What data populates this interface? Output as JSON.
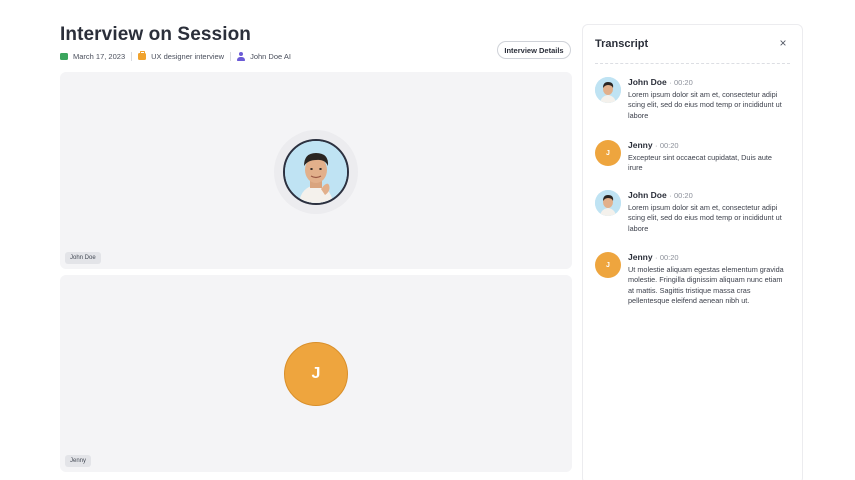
{
  "header": {
    "title": "Interview on Session",
    "date": "March 17, 2023",
    "position": "UX designer interview",
    "interviewer": "John Doe AI",
    "details_button": "Interview Details"
  },
  "video": {
    "tiles": [
      {
        "name": "John Doe",
        "initial": ""
      },
      {
        "name": "Jenny",
        "initial": "J"
      }
    ]
  },
  "transcript": {
    "title": "Transcript",
    "close_symbol": "×",
    "entries": [
      {
        "speaker": "John Doe",
        "separator": "·",
        "time": "00:20",
        "text": "Lorem ipsum dolor sit am et, consectetur adipi scing elit, sed do eius mod temp or incididunt ut labore",
        "initial": ""
      },
      {
        "speaker": "Jenny",
        "separator": "·",
        "time": "00:20",
        "text": "Excepteur sint occaecat cupidatat, Duis aute irure",
        "initial": "J"
      },
      {
        "speaker": "John Doe",
        "separator": "·",
        "time": "00:20",
        "text": "Lorem ipsum dolor sit am et, consectetur adipi scing elit, sed do eius mod temp or incididunt ut labore",
        "initial": ""
      },
      {
        "speaker": "Jenny",
        "separator": "·",
        "time": "00:20",
        "text": "Ut molestie aliquam egestas elementum gravida molestie. Fringilla dignissim aliquam nunc etiam at mattis. Sagittis tristique massa cras pellentesque eleifend aenean nibh ut.",
        "initial": "J"
      }
    ]
  },
  "icons": {
    "date": "calendar-icon",
    "position": "briefcase-icon",
    "interviewer": "user-icon",
    "close": "close-icon"
  },
  "colors": {
    "accent_orange": "#eea53e",
    "calendar_green": "#3ba55d",
    "user_purple": "#6b5bd6",
    "tile_bg": "#f4f4f6"
  }
}
